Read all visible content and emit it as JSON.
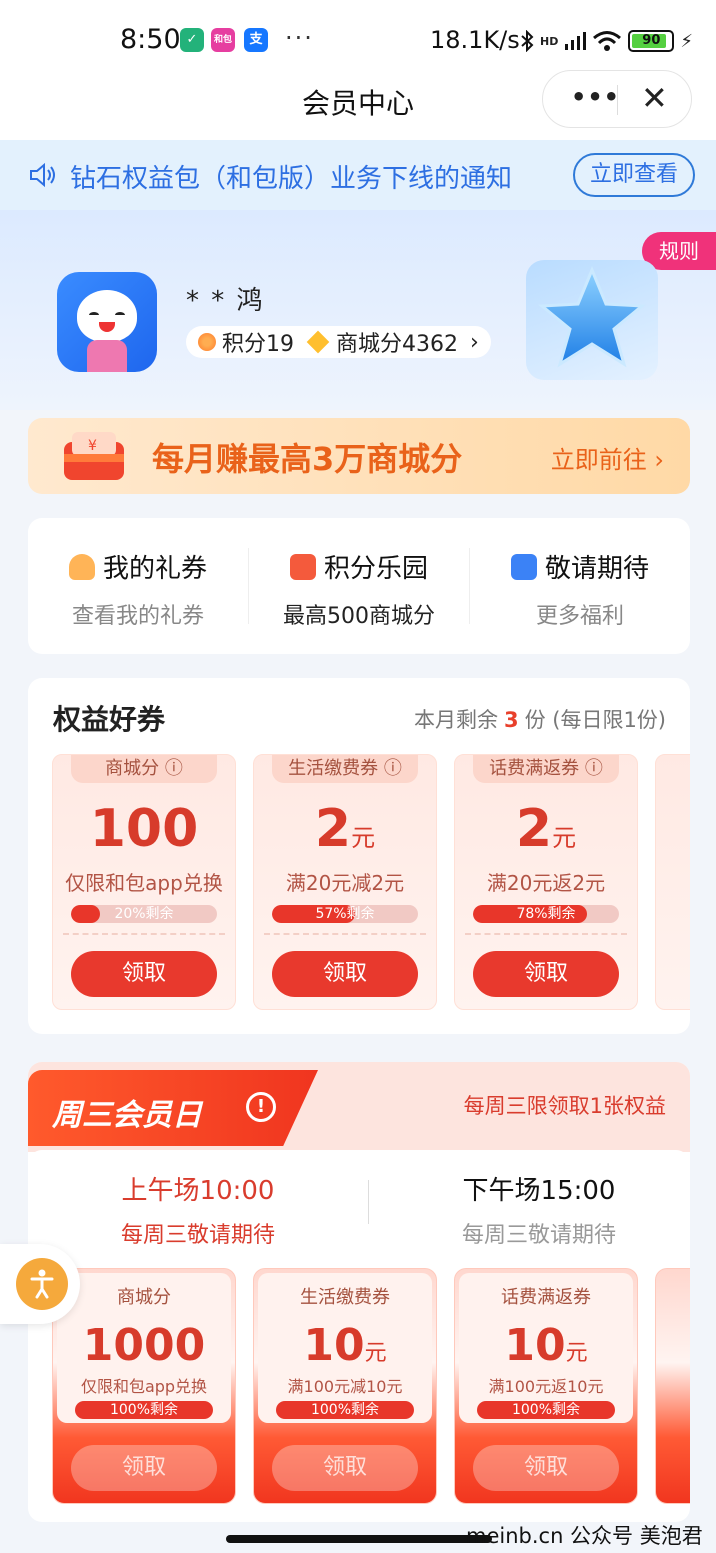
{
  "status_bar": {
    "time": "8:50",
    "apps": [
      "和包",
      "支"
    ],
    "dots": "···",
    "speed": "18.1K/s",
    "signal": "HD",
    "battery": "90",
    "battery_level": 0.9
  },
  "titlebar": {
    "title": "会员中心",
    "more": "•••",
    "close": "✕"
  },
  "notice": {
    "text": "钻石权益包（和包版）业务下线的通知",
    "button": "立即查看"
  },
  "profile": {
    "rule_tag": "规则",
    "name": "* * 鸿",
    "points_label": "积分19",
    "mall_label": "商城分4362",
    "chevron": "›"
  },
  "banner": {
    "title": "每月赚最高3万商城分",
    "action": "立即前往 ›"
  },
  "shortcuts": [
    {
      "title": "我的礼券",
      "sub": "查看我的礼券"
    },
    {
      "title": "积分乐园",
      "sub": "最高500商城分"
    },
    {
      "title": "敬请期待",
      "sub": "更多福利"
    }
  ],
  "coupons": {
    "heading": "权益好券",
    "remain_prefix": "本月剩余",
    "remain_count": "3",
    "remain_suffix": "份 (每日限1份)",
    "items": [
      {
        "tag": "商城分 ⓘ",
        "value": "100",
        "unit": "",
        "desc": "仅限和包app兑换",
        "remain": "20%剩余",
        "remain_fraction": 0.2,
        "button": "领取"
      },
      {
        "tag": "生活缴费券 ⓘ",
        "value": "2",
        "unit": "元",
        "desc": "满20元减2元",
        "remain": "57%剩余",
        "remain_fraction": 0.57,
        "button": "领取"
      },
      {
        "tag": "话费满返券 ⓘ",
        "value": "2",
        "unit": "元",
        "desc": "满20元返2元",
        "remain": "78%剩余",
        "remain_fraction": 0.78,
        "button": "领取"
      }
    ]
  },
  "wednesday": {
    "title": "周三会员日",
    "info": "!",
    "limit": "每周三限领取1张权益",
    "sessions": [
      {
        "time": "上午场10:00",
        "sub": "每周三敬请期待"
      },
      {
        "time": "下午场15:00",
        "sub": "每周三敬请期待"
      }
    ],
    "items": [
      {
        "tag": "商城分",
        "value": "1000",
        "unit": "",
        "desc": "仅限和包app兑换",
        "remain": "100%剩余",
        "button": "领取"
      },
      {
        "tag": "生活缴费券",
        "value": "10",
        "unit": "元",
        "desc": "满100元减10元",
        "remain": "100%剩余",
        "button": "领取"
      },
      {
        "tag": "话费满返券",
        "value": "10",
        "unit": "元",
        "desc": "满100元返10元",
        "remain": "100%剩余",
        "button": "领取"
      }
    ]
  },
  "float_button": {
    "icon": "accessibility-icon"
  },
  "watermark": "meinb.cn  公众号 美泡君"
}
